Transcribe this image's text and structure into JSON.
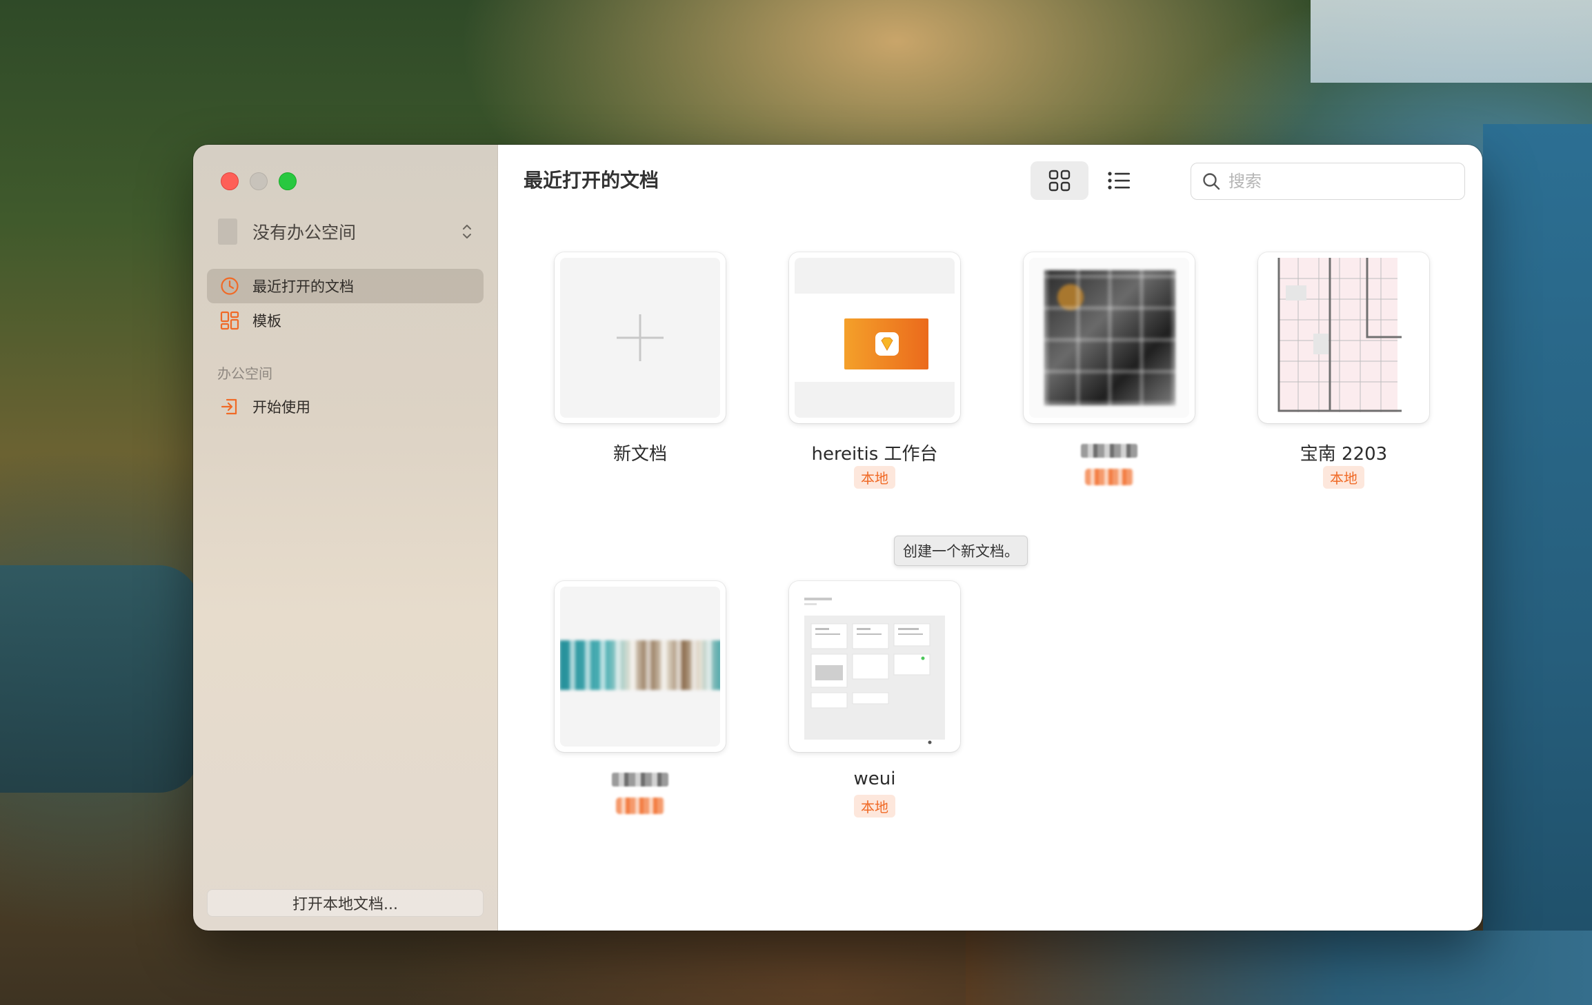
{
  "window": {
    "workspace_selector": "没有办公空间",
    "open_local_button": "打开本地文档..."
  },
  "sidebar": {
    "items": [
      {
        "label": "最近打开的文档",
        "icon": "clock-icon",
        "active": true
      },
      {
        "label": "模板",
        "icon": "template-grid-icon",
        "active": false
      }
    ],
    "section_label": "办公空间",
    "workspace_items": [
      {
        "label": "开始使用",
        "icon": "sign-in-icon"
      }
    ]
  },
  "main": {
    "title": "最近打开的文档",
    "search_placeholder": "搜索",
    "active_view": "grid",
    "accent_color": "#f06a26"
  },
  "documents": [
    {
      "name": "新文档",
      "badge": ""
    },
    {
      "name": "hereitis 工作台",
      "badge": "本地"
    },
    {
      "name": "",
      "badge": ""
    },
    {
      "name": "宝南 2203",
      "badge": "本地"
    },
    {
      "name": "",
      "badge": ""
    },
    {
      "name": "weui",
      "badge": "本地"
    }
  ],
  "tooltip": "创建一个新文档。"
}
